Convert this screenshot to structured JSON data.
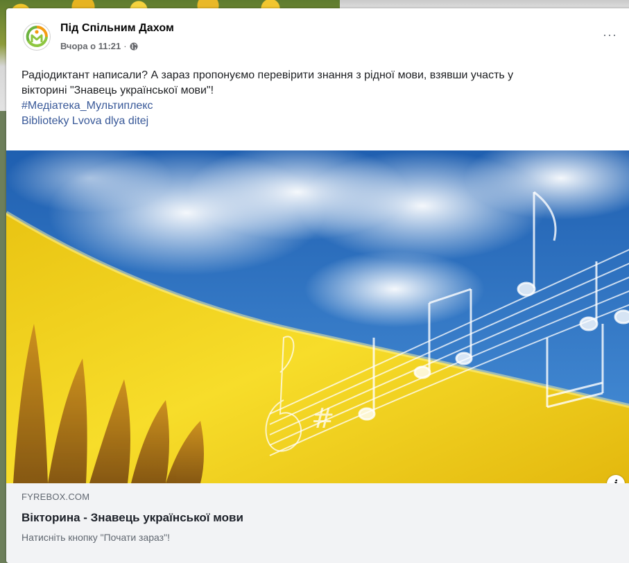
{
  "post": {
    "page_name": "Під Спільним Дахом",
    "timestamp": "Вчора о 11:21",
    "separator": "·",
    "privacy_icon": "globe-icon",
    "more_icon": "more-options-icon",
    "more_label": "···",
    "text_line1": "Радіодиктант написали? А зараз пропонуємо перевірити знання з рідної мови, взявши участь у",
    "text_line2": "вікторині \"Знавець української мови\"!",
    "hashtag": "#Медіатека_Мультиплекс",
    "mention": "Biblioteky Lvova dlya ditej"
  },
  "link_preview": {
    "domain": "FYREBOX.COM",
    "title": "Вікторина - Знавець української мови",
    "description": "Натисніть кнопку \"Почати зараз\"!",
    "info_label": "i"
  },
  "colors": {
    "flag_blue": "#2f7fd0",
    "flag_yellow": "#f3d21c",
    "link": "#385898",
    "avatar_green": "#8dc63f",
    "avatar_orange": "#f39c12"
  }
}
